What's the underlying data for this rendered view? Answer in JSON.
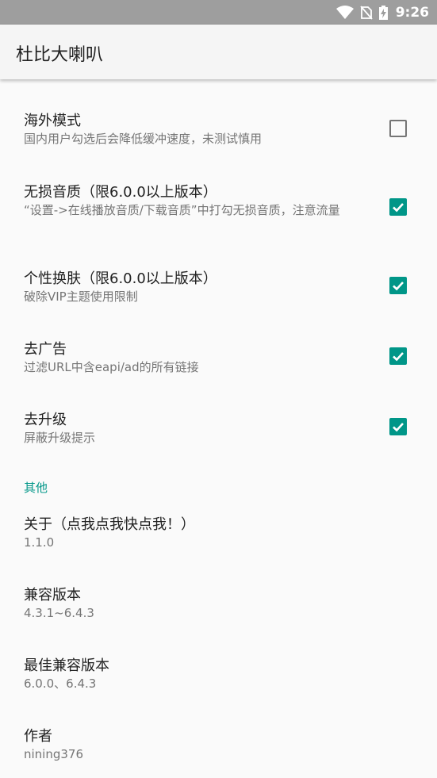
{
  "status_bar": {
    "time": "9:26"
  },
  "app": {
    "title": "杜比大喇叭"
  },
  "prefs": [
    {
      "title": "海外模式",
      "summary": "国内用户勾选后会降低缓冲速度，未测试慎用",
      "checked": false
    },
    {
      "title": "无损音质（限6.0.0以上版本）",
      "summary": "“设置->在线播放音质/下载音质”中打勾无损音质，注意流量",
      "checked": true
    },
    {
      "title": "个性换肤（限6.0.0以上版本）",
      "summary": "破除VIP主题使用限制",
      "checked": true
    },
    {
      "title": "去广告",
      "summary": "过滤URL中含eapi/ad的所有链接",
      "checked": true
    },
    {
      "title": "去升级",
      "summary": "屏蔽升级提示",
      "checked": true
    }
  ],
  "other": {
    "category": "其他",
    "items": [
      {
        "title": "关于（点我点我快点我！）",
        "summary": "1.1.0"
      },
      {
        "title": "兼容版本",
        "summary": "4.3.1~6.4.3"
      },
      {
        "title": "最佳兼容版本",
        "summary": "6.0.0、6.4.3"
      },
      {
        "title": "作者",
        "summary": "nining376"
      }
    ]
  },
  "colors": {
    "accent": "#009688",
    "status_bar": "#9e9e9e",
    "app_bar": "#f5f5f5"
  }
}
